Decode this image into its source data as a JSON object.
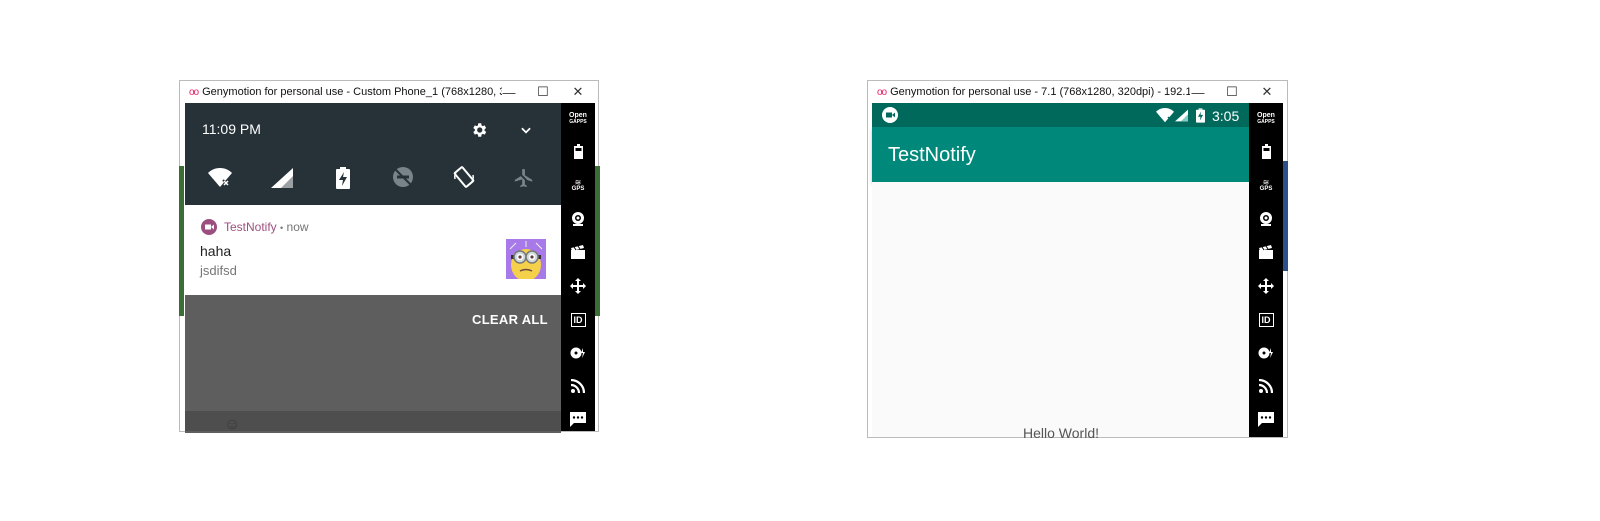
{
  "left_window": {
    "title": "Genymotion for personal use - Custom Phone_1 (768x1280, 320dp...",
    "controls": {
      "minimize": "—",
      "maximize": "☐",
      "close": "✕"
    },
    "quick_settings": {
      "time": "11:09 PM",
      "settings_icon": "gear-icon",
      "expand_icon": "chevron-down-icon",
      "tiles": [
        "wifi-off-icon",
        "cellular-signal-icon",
        "battery-charging-icon",
        "do-not-disturb-off-icon",
        "auto-rotate-icon",
        "airplane-mode-icon"
      ]
    },
    "notification": {
      "app_name": "TestNotify",
      "separator": "•",
      "time": "now",
      "title": "haha",
      "text": "jsdifsd",
      "accent_color": "#9c4f7e"
    },
    "clear_all_label": "CLEAR ALL"
  },
  "right_window": {
    "title": "Genymotion for personal use - 7.1 (768x1280, 320dpi) - 192.168.6...",
    "controls": {
      "minimize": "—",
      "maximize": "☐",
      "close": "✕"
    },
    "status_bar": {
      "time": "3:05"
    },
    "app_title": "TestNotify",
    "content_text": "Hello World!",
    "colors": {
      "primary": "#00897b",
      "primary_dark": "#00695c"
    }
  },
  "sidebar": {
    "open_gapps_line1": "Open",
    "open_gapps_line2": "GAPPS",
    "gps_label": "GPS",
    "id_label": "ID",
    "icons": [
      "open-gapps-icon",
      "battery-icon",
      "gps-icon",
      "camera-icon",
      "media-icon",
      "navigation-icon",
      "id-icon",
      "disk-icon",
      "rss-icon",
      "sms-icon"
    ]
  }
}
